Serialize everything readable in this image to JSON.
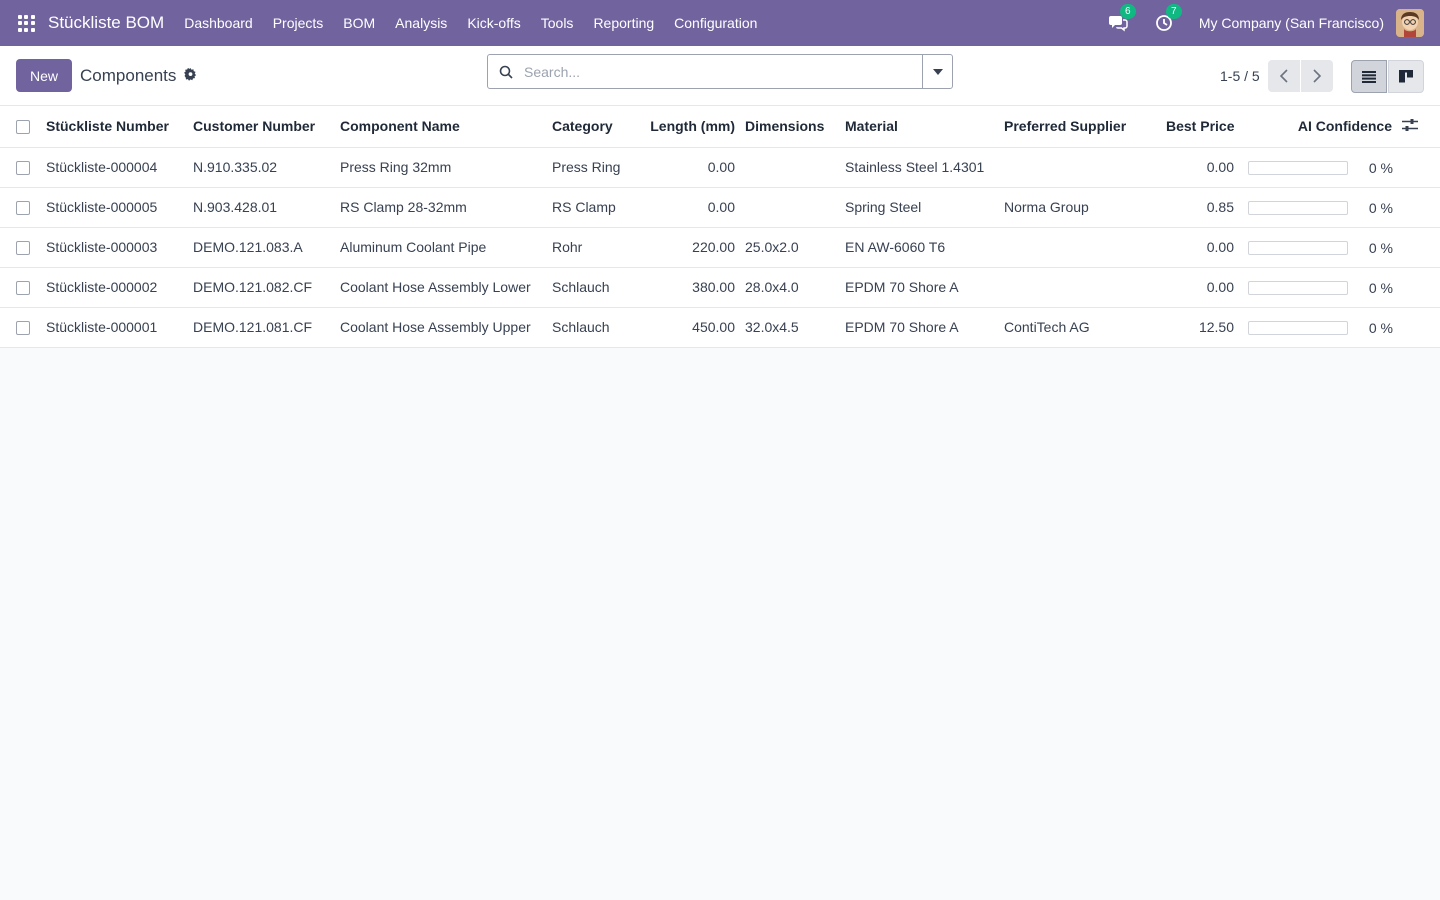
{
  "navbar": {
    "brand": "Stückliste BOM",
    "menu": [
      "Dashboard",
      "Projects",
      "BOM",
      "Analysis",
      "Kick-offs",
      "Tools",
      "Reporting",
      "Configuration"
    ],
    "messages_badge": "6",
    "activities_badge": "7",
    "company": "My Company (San Francisco)",
    "color": "#71639e"
  },
  "control": {
    "new_label": "New",
    "title": "Components",
    "search_placeholder": "Search...",
    "pager": "1-5 / 5"
  },
  "table": {
    "headers": [
      "Stückliste Number",
      "Customer Number",
      "Component Name",
      "Category",
      "Length (mm)",
      "Dimensions",
      "Material",
      "Preferred Supplier",
      "Best Price",
      "AI Confidence"
    ],
    "rows": [
      {
        "number": "Stückliste-000004",
        "customer": "N.910.335.02",
        "name": "Press Ring 32mm",
        "category": "Press Ring",
        "length": "0.00",
        "dimensions": "",
        "material": "Stainless Steel 1.4301",
        "supplier": "",
        "price": "0.00",
        "confidence": "0 %",
        "confidence_value": 0
      },
      {
        "number": "Stückliste-000005",
        "customer": "N.903.428.01",
        "name": "RS Clamp 28-32mm",
        "category": "RS Clamp",
        "length": "0.00",
        "dimensions": "",
        "material": "Spring Steel",
        "supplier": "Norma Group",
        "price": "0.85",
        "confidence": "0 %",
        "confidence_value": 0
      },
      {
        "number": "Stückliste-000003",
        "customer": "DEMO.121.083.A",
        "name": "Aluminum Coolant Pipe",
        "category": "Rohr",
        "length": "220.00",
        "dimensions": "25.0x2.0",
        "material": "EN AW-6060 T6",
        "supplier": "",
        "price": "0.00",
        "confidence": "0 %",
        "confidence_value": 0
      },
      {
        "number": "Stückliste-000002",
        "customer": "DEMO.121.082.CF",
        "name": "Coolant Hose Assembly Lower",
        "category": "Schlauch",
        "length": "380.00",
        "dimensions": "28.0x4.0",
        "material": "EPDM 70 Shore A",
        "supplier": "",
        "price": "0.00",
        "confidence": "0 %",
        "confidence_value": 0
      },
      {
        "number": "Stückliste-000001",
        "customer": "DEMO.121.081.CF",
        "name": "Coolant Hose Assembly Upper",
        "category": "Schlauch",
        "length": "450.00",
        "dimensions": "32.0x4.5",
        "material": "EPDM 70 Shore A",
        "supplier": "ContiTech AG",
        "price": "12.50",
        "confidence": "0 %",
        "confidence_value": 0
      }
    ]
  }
}
